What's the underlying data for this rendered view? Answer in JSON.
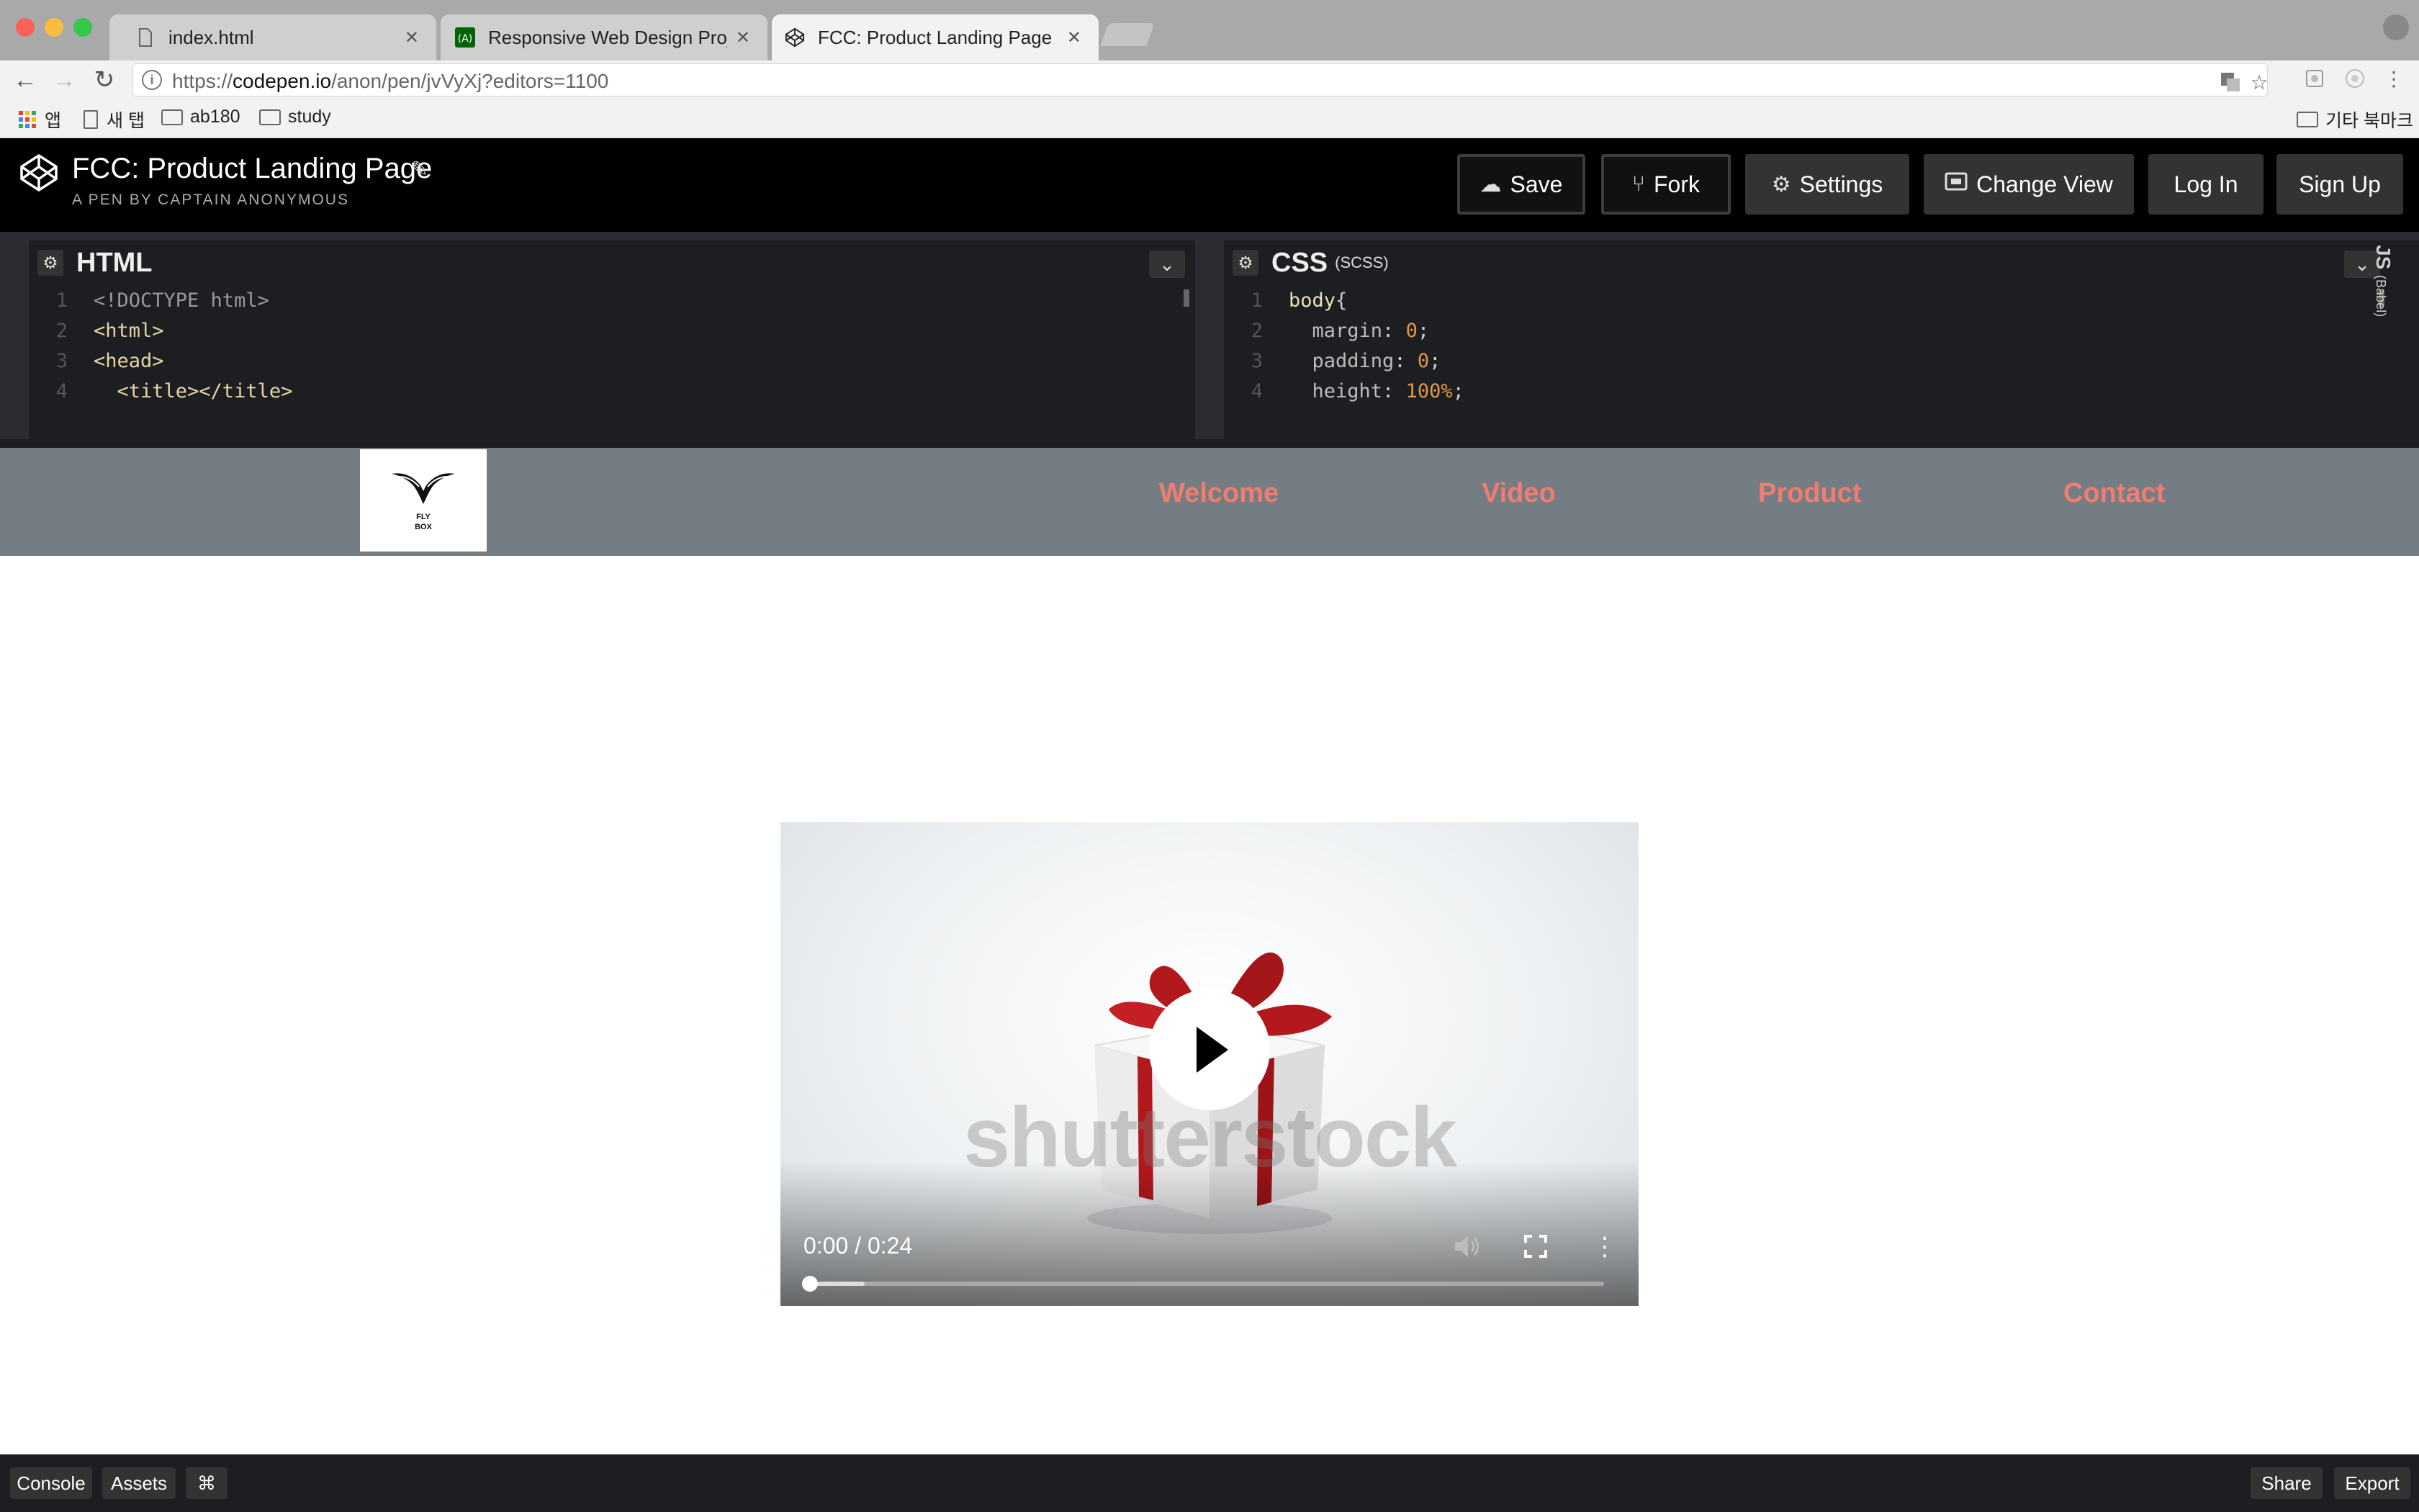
{
  "browser": {
    "tabs": [
      {
        "label": "index.html",
        "active": false
      },
      {
        "label": "Responsive Web Design Projec",
        "active": false
      },
      {
        "label": "FCC: Product Landing Page",
        "active": true
      }
    ],
    "url_prefix": "https://",
    "url_host": "codepen.io",
    "url_path": "/anon/pen/jvVyXj?editors=1100",
    "bookmarks": {
      "apps": "앱",
      "new_tab": "새 탭",
      "folder1": "ab180",
      "folder2": "study",
      "other": "기타 북마크"
    }
  },
  "codepen": {
    "title": "FCC: Product Landing Page",
    "byline": "A PEN BY CAPTAIN ANONYMOUS",
    "buttons": {
      "save": "Save",
      "fork": "Fork",
      "settings": "Settings",
      "change_view": "Change View",
      "login": "Log In",
      "signup": "Sign Up"
    },
    "html_editor": {
      "title": "HTML",
      "lines": [
        {
          "n": "1",
          "text": "<!DOCTYPE html>"
        },
        {
          "n": "2",
          "text": "<html>"
        },
        {
          "n": "3",
          "text": "<head>"
        },
        {
          "n": "4",
          "text": "  <title></title>"
        }
      ]
    },
    "css_editor": {
      "title": "CSS",
      "subtitle": "(SCSS)",
      "lines": [
        {
          "n": "1",
          "sel": "body",
          "pun": "{"
        },
        {
          "n": "2",
          "prop": "  margin",
          "val": "0"
        },
        {
          "n": "3",
          "prop": "  padding",
          "val": "0"
        },
        {
          "n": "4",
          "prop": "  height",
          "val": "100%"
        }
      ]
    },
    "js_label": "JS",
    "js_sub": "(Babel)",
    "footer": {
      "console": "Console",
      "assets": "Assets",
      "shortcuts": "⌘",
      "share": "Share",
      "export": "Export"
    }
  },
  "site": {
    "logo_text1": "FLY",
    "logo_text2": "BOX",
    "nav": [
      "Welcome",
      "Video",
      "Product",
      "Contact"
    ],
    "link_color": "#f07d6f",
    "nav_bg": "#757d84"
  },
  "video": {
    "time": "0:00 / 0:24",
    "watermark": "shutterstock",
    "progress": 0,
    "buffered": 0.07
  }
}
